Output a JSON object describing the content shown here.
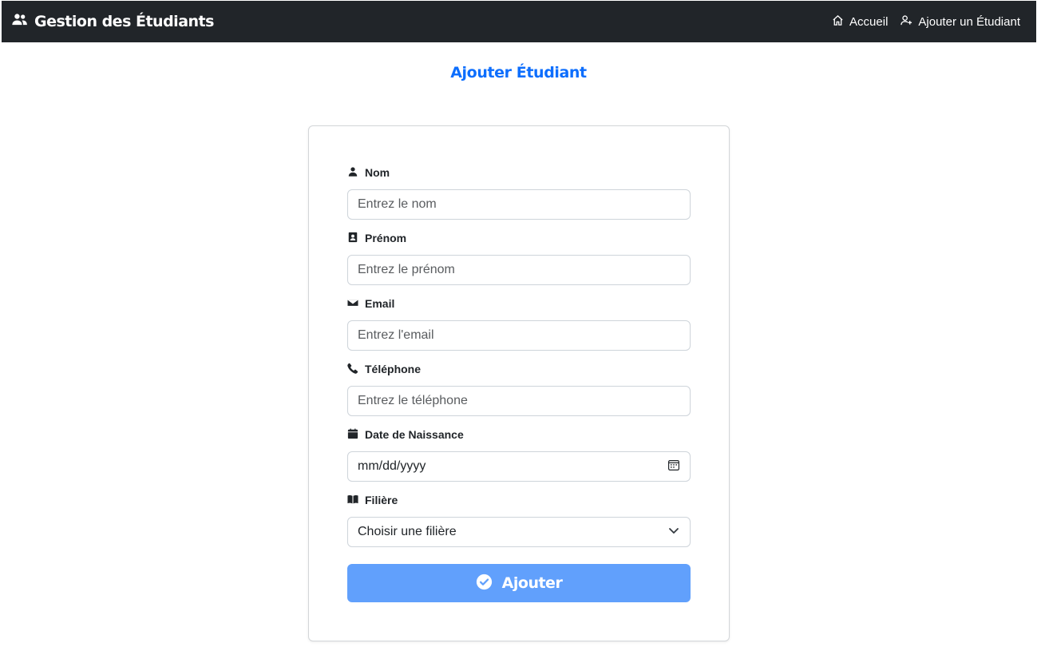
{
  "navbar": {
    "brand": "Gestion des Étudiants",
    "brand_icon": "users-icon",
    "links": [
      {
        "label": "Accueil",
        "icon": "home-icon"
      },
      {
        "label": "Ajouter un Étudiant",
        "icon": "user-plus-icon"
      }
    ]
  },
  "page": {
    "title": "Ajouter Étudiant"
  },
  "form": {
    "nom": {
      "label": "Nom",
      "placeholder": "Entrez le nom",
      "value": "",
      "icon": "person-icon"
    },
    "prenom": {
      "label": "Prénom",
      "placeholder": "Entrez le prénom",
      "value": "",
      "icon": "id-badge-icon"
    },
    "email": {
      "label": "Email",
      "placeholder": "Entrez l'email",
      "value": "",
      "icon": "envelope-icon"
    },
    "telephone": {
      "label": "Téléphone",
      "placeholder": "Entrez le téléphone",
      "value": "",
      "icon": "phone-icon"
    },
    "date_naissance": {
      "label": "Date de Naissance",
      "display": "mm/dd/yyyy",
      "icon": "calendar-icon",
      "picker_icon": "calendar-picker-icon"
    },
    "filiere": {
      "label": "Filière",
      "selected": "Choisir une filière",
      "icon": "book-icon"
    },
    "submit": {
      "label": "Ajouter",
      "icon": "check-circle-icon"
    }
  },
  "colors": {
    "navbar_bg": "#212529",
    "title": "#0d6efd",
    "button_bg": "#61a0fc",
    "input_border": "#ced4da"
  }
}
